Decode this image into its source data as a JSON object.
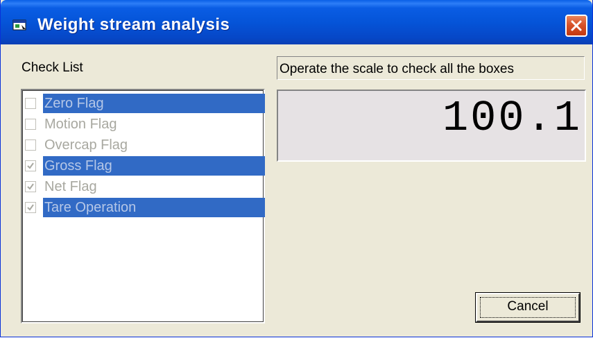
{
  "window": {
    "title": "Weight stream analysis",
    "title_icon": "window-app-icon",
    "close_icon": "close-icon"
  },
  "checklist": {
    "label": "Check List",
    "items": [
      {
        "label": "Zero Flag",
        "checked": false,
        "selected": true
      },
      {
        "label": "Motion Flag",
        "checked": false,
        "selected": false
      },
      {
        "label": "Overcap Flag",
        "checked": false,
        "selected": false
      },
      {
        "label": "Gross Flag",
        "checked": true,
        "selected": true
      },
      {
        "label": "Net Flag",
        "checked": true,
        "selected": false
      },
      {
        "label": "Tare Operation",
        "checked": true,
        "selected": true
      }
    ]
  },
  "status": {
    "text": "Operate the scale to check all the boxes"
  },
  "weight": {
    "value": "100.1"
  },
  "buttons": {
    "cancel_label": "Cancel"
  },
  "colors": {
    "titlebar": "#0554d8",
    "selection": "#316ac5",
    "dialog_bg": "#ece9d8",
    "display_bg": "#e6e2e4",
    "close_button": "#d8532a"
  }
}
